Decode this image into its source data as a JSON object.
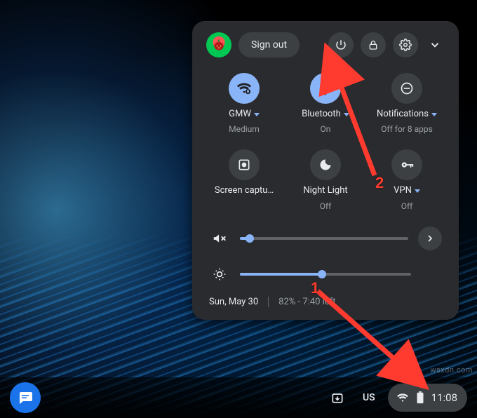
{
  "panel": {
    "sign_out_label": "Sign out",
    "tiles": [
      {
        "label": "GMW",
        "sub": "Medium",
        "has_caret": true,
        "on": true,
        "icon": "wifi-lock"
      },
      {
        "label": "Bluetooth",
        "sub": "On",
        "has_caret": true,
        "on": true,
        "icon": "bluetooth"
      },
      {
        "label": "Notifications",
        "sub": "Off for 8 apps",
        "has_caret": true,
        "on": false,
        "icon": "dnd"
      },
      {
        "label": "Screen captu…",
        "sub": "",
        "has_caret": false,
        "on": false,
        "icon": "screen-capture"
      },
      {
        "label": "Night Light",
        "sub": "Off",
        "has_caret": false,
        "on": false,
        "icon": "night-light"
      },
      {
        "label": "VPN",
        "sub": "Off",
        "has_caret": true,
        "on": false,
        "icon": "vpn-key"
      }
    ],
    "volume_percent": 6,
    "brightness_percent": 48,
    "date": "Sun, May 30",
    "battery_text": "82% - 7:40 left"
  },
  "shelf": {
    "keyboard_label": "US",
    "clock": "11:08"
  },
  "annotations": {
    "one": "1",
    "two": "2"
  },
  "watermark": "wsxdn.com"
}
